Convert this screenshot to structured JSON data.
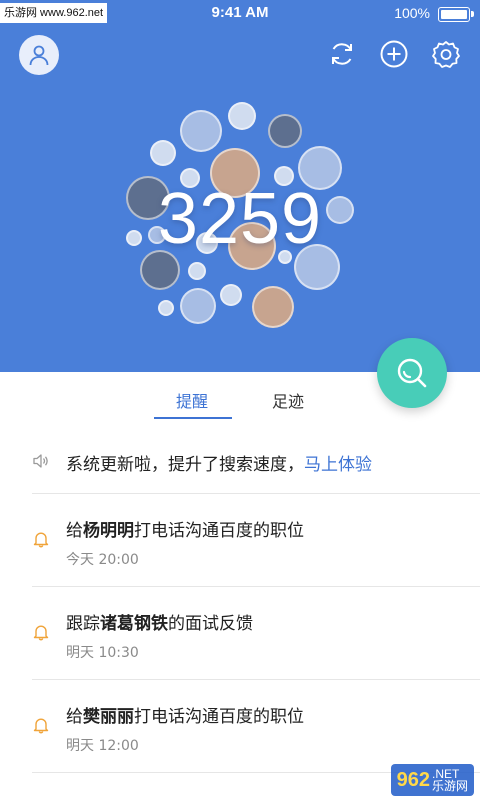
{
  "statusbar": {
    "watermark": "乐游网 www.962.net",
    "time": "9:41 AM",
    "battery_pct": "100%"
  },
  "header": {
    "avatar_icon": "user-icon",
    "icons": [
      "refresh-icon",
      "add-circle-icon",
      "gear-icon"
    ]
  },
  "hero": {
    "count": "3259",
    "background": "#4a7fd9"
  },
  "fab": {
    "icon": "search-icon",
    "color": "#48cdb8"
  },
  "tabs": [
    {
      "label": "提醒",
      "active": true
    },
    {
      "label": "足迹",
      "active": false
    }
  ],
  "notice": {
    "icon": "speaker-icon",
    "text": "系统更新啦，提升了搜索速度，",
    "link": "马上体验"
  },
  "reminders": [
    {
      "icon": "bell-icon",
      "pre": "给",
      "name": "杨明明",
      "post": "打电话沟通百度的职位",
      "time": "今天 20:00"
    },
    {
      "icon": "bell-icon",
      "pre": "跟踪",
      "name": "诸葛钢铁",
      "post": "的面试反馈",
      "time": "明天 10:30"
    },
    {
      "icon": "bell-icon",
      "pre": "给",
      "name": "樊丽丽",
      "post": "打电话沟通百度的职位",
      "time": "明天 12:00"
    }
  ],
  "watermark_bottom": {
    "logo": "962",
    "net": ".NET",
    "site": "乐游网"
  },
  "colors": {
    "accent": "#3d73d4",
    "bell": "#f0a43a"
  }
}
